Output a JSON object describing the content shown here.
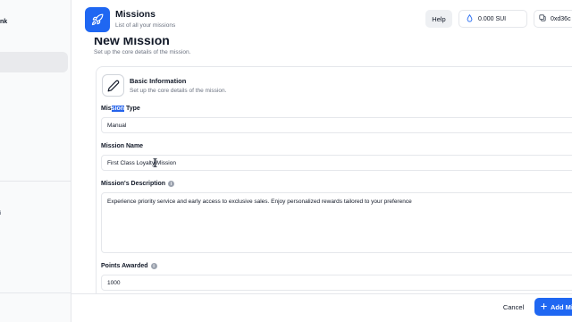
{
  "sidebar": {
    "brand_fragment": "nk",
    "mark_fragment": "i"
  },
  "header": {
    "title": "Missions",
    "subtitle": "List of all your missions",
    "help_label": "Help",
    "wallet_balance": "0.000 SUI",
    "address": "0xd36c"
  },
  "page": {
    "title": "New Mission",
    "subtitle": "Set up the core details of the mission."
  },
  "card": {
    "title": "Basic Information",
    "subtitle": "Set up the core details of the mission."
  },
  "form": {
    "mission_type": {
      "label_pre": "Mis",
      "label_highlight": "sion",
      "label_post": " Type",
      "value": "Manual"
    },
    "mission_name": {
      "label": "Mission Name",
      "value": "First Class Loyalty Mission"
    },
    "mission_description": {
      "label": "Mission's Description",
      "value": "Experience priority service and early access to exclusive sales. Enjoy personalized rewards tailored to your preference"
    },
    "points_awarded": {
      "label": "Points Awarded",
      "value": "1000"
    }
  },
  "footer": {
    "cancel_label": "Cancel",
    "add_label": "Add Mi"
  },
  "colors": {
    "accent": "#1f67f2",
    "border": "#e5e7eb",
    "muted_text": "#6b7280"
  },
  "icons": {
    "header": "rocket-icon",
    "card": "pencil-icon",
    "wallet": "sui-drop-icon",
    "address": "copy-icon",
    "add": "plus-icon",
    "info": "info-icon"
  }
}
